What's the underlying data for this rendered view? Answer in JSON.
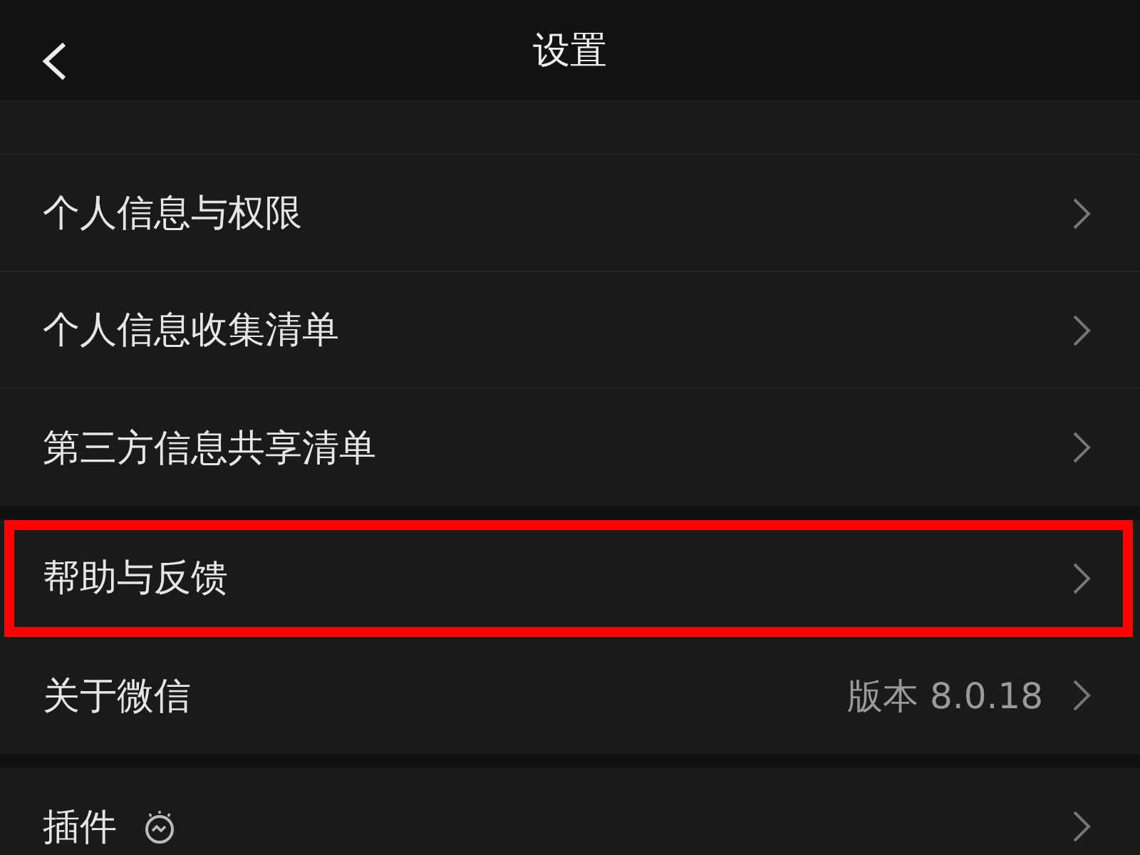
{
  "header": {
    "title": "设置"
  },
  "groups": [
    {
      "items": [
        {
          "label": "个人信息与权限",
          "highlighted": false
        },
        {
          "label": "个人信息收集清单",
          "highlighted": false
        },
        {
          "label": "第三方信息共享清单",
          "highlighted": false
        }
      ]
    },
    {
      "items": [
        {
          "label": "帮助与反馈",
          "highlighted": true
        },
        {
          "label": "关于微信",
          "value": "版本 8.0.18",
          "highlighted": false
        }
      ]
    },
    {
      "items": [
        {
          "label": "插件",
          "badge_icon": true,
          "highlighted": false
        }
      ]
    }
  ]
}
